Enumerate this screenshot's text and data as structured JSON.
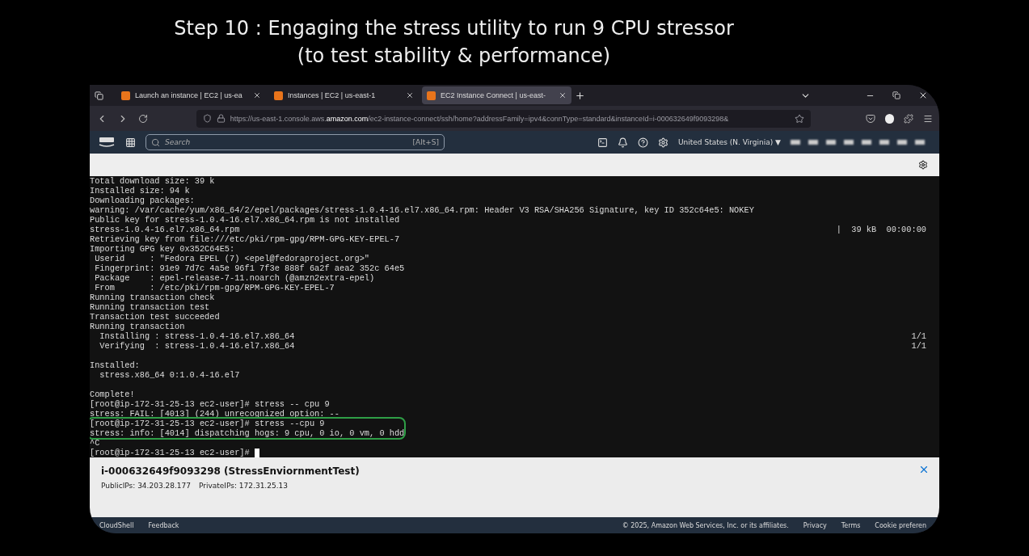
{
  "slide_title": [
    "Step 10 : Engaging the stress utility to run 9 CPU stressor",
    "(to test stability & performance)"
  ],
  "browser": {
    "tabs": [
      {
        "label": "Launch an instance | EC2 | us-ea",
        "selected": false
      },
      {
        "label": "Instances | EC2 | us-east-1",
        "selected": false
      },
      {
        "label": "EC2 Instance Connect | us-east-",
        "selected": true
      }
    ],
    "url_prefix": "https://us-east-1.console.aws.",
    "url_domain": "amazon.com",
    "url_rest": "/ec2-instance-connect/ssh/home?addressFamily=ipv4&connType=standard&instanceId=i-000632649f9093298&"
  },
  "aws_nav": {
    "search_placeholder": "Search",
    "search_shortcut": "[Alt+S]",
    "region": "United States (N. Virginia)",
    "region_caret": "▼"
  },
  "terminal": {
    "lines": [
      {
        "text": "Total download size: 39 k",
        "highlighted": false
      },
      {
        "text": "Installed size: 94 k",
        "highlighted": false
      },
      {
        "text": "Downloading packages:",
        "highlighted": false
      },
      {
        "text": "warning: /var/cache/yum/x86_64/2/epel/packages/stress-1.0.4-16.el7.x86_64.rpm: Header V3 RSA/SHA256 Signature, key ID 352c64e5: NOKEY",
        "highlighted": false
      },
      {
        "text": "Public key for stress-1.0.4-16.el7.x86_64.rpm is not installed",
        "highlighted": false
      },
      {
        "text": "stress-1.0.4-16.el7.x86_64.rpm",
        "right": "|  39 kB  00:00:00",
        "highlighted": false
      },
      {
        "text": "Retrieving key from file:///etc/pki/rpm-gpg/RPM-GPG-KEY-EPEL-7",
        "highlighted": false
      },
      {
        "text": "Importing GPG key 0x352C64E5:",
        "highlighted": false
      },
      {
        "text": " Userid     : \"Fedora EPEL (7) <epel@fedoraproject.org>\"",
        "highlighted": false
      },
      {
        "text": " Fingerprint: 91e9 7d7c 4a5e 96f1 7f3e 888f 6a2f aea2 352c 64e5",
        "highlighted": false
      },
      {
        "text": " Package    : epel-release-7-11.noarch (@amzn2extra-epel)",
        "highlighted": false
      },
      {
        "text": " From       : /etc/pki/rpm-gpg/RPM-GPG-KEY-EPEL-7",
        "highlighted": false
      },
      {
        "text": "Running transaction check",
        "highlighted": false
      },
      {
        "text": "Running transaction test",
        "highlighted": false
      },
      {
        "text": "Transaction test succeeded",
        "highlighted": false
      },
      {
        "text": "Running transaction",
        "highlighted": false
      },
      {
        "text": "  Installing : stress-1.0.4-16.el7.x86_64",
        "right": "1/1",
        "highlighted": false
      },
      {
        "text": "  Verifying  : stress-1.0.4-16.el7.x86_64",
        "right": "1/1",
        "highlighted": false
      },
      {
        "kind": "blank"
      },
      {
        "text": "Installed:",
        "highlighted": false
      },
      {
        "text": "  stress.x86_64 0:1.0.4-16.el7",
        "highlighted": false
      },
      {
        "kind": "blank"
      },
      {
        "text": "Complete!",
        "highlighted": false
      },
      {
        "text": "[root@ip-172-31-25-13 ec2-user]# stress -- cpu 9",
        "highlighted": false
      },
      {
        "text": "stress: FAIL: [4013] (244) unrecognized option: --",
        "highlighted": false
      },
      {
        "text": "[root@ip-172-31-25-13 ec2-user]# stress --cpu 9",
        "highlighted": true
      },
      {
        "text": "stress: info: [4014] dispatching hogs: 9 cpu, 0 io, 0 vm, 0 hdd",
        "highlighted": true
      },
      {
        "text": "^C",
        "highlighted": false
      },
      {
        "text": "[root@ip-172-31-25-13 ec2-user]# ",
        "cursor": true,
        "highlighted": false
      }
    ]
  },
  "instance_panel": {
    "title": "i-000632649f9093298 (StressEnviornmentTest)",
    "public_ips": "PublicIPs: 34.203.28.177",
    "private_ips": "PrivateIPs: 172.31.25.13"
  },
  "footer": {
    "left": [
      "CloudShell",
      "Feedback"
    ],
    "copyright": "© 2025, Amazon Web Services, Inc. or its affiliates.",
    "links": [
      "Privacy",
      "Terms",
      "Cookie preferen"
    ]
  }
}
